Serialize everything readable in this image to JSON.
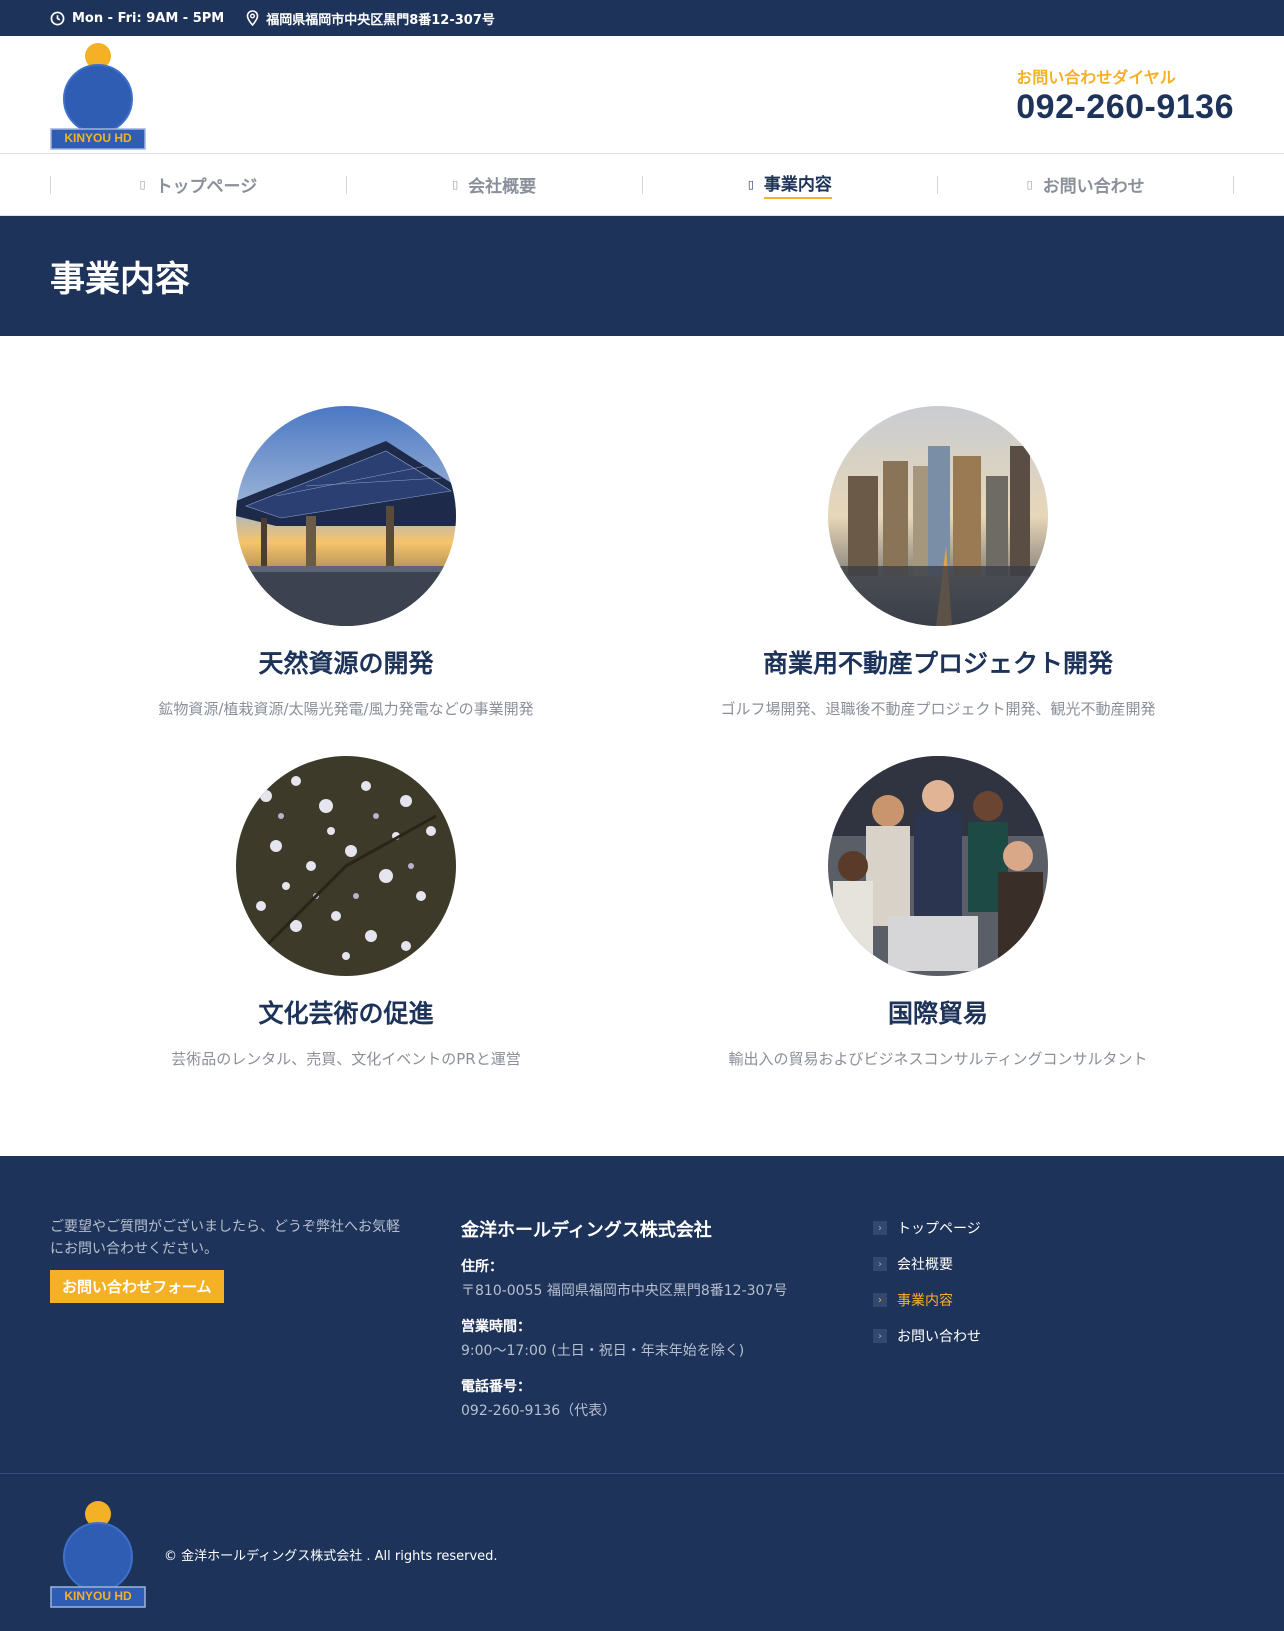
{
  "topbar": {
    "hours": "Mon - Fri: 9AM - 5PM",
    "address": "福岡県福岡市中央区黒門8番12-307号"
  },
  "brand": {
    "logo_text": "KINYOU HD",
    "colors": {
      "navy": "#1e3359",
      "gold": "#f5b125",
      "logo_blue": "#2f5db3"
    }
  },
  "contact": {
    "dial_label": "お問い合わせダイヤル",
    "dial_number": "092-260-9136"
  },
  "nav": {
    "items": [
      {
        "label": "トップページ",
        "active": false
      },
      {
        "label": "会社概要",
        "active": false
      },
      {
        "label": "事業内容",
        "active": true
      },
      {
        "label": "お問い合わせ",
        "active": false
      }
    ]
  },
  "page": {
    "title": "事業内容"
  },
  "services": [
    {
      "title": "天然資源の開発",
      "description": "鉱物資源/植栽資源/太陽光発電/風力発電などの事業開発",
      "image": "solar-panels-photo"
    },
    {
      "title": "商業用不動産プロジェクト開発",
      "description": "ゴルフ場開発、退職後不動産プロジェクト開発、観光不動産開発",
      "image": "city-skyline-photo"
    },
    {
      "title": "文化芸術の促進",
      "description": "芸術品のレンタル、売買、文化イベントのPRと運営",
      "image": "blossom-tree-photo"
    },
    {
      "title": "国際貿易",
      "description": "輸出入の貿易およびビジネスコンサルティングコンサルタント",
      "image": "business-team-photo"
    }
  ],
  "footer": {
    "message": "ご要望やご質問がございましたら、どうぞ弊社へお気軽にお問い合わせください。",
    "form_button": "お問い合わせフォーム",
    "company": "金洋ホールディングス株式会社",
    "address_label": "住所：",
    "address_value": "〒810-0055 福岡県福岡市中央区黒門8番12-307号",
    "hours_label": "営業時間：",
    "hours_value": "9:00〜17:00 (土日・祝日・年末年始を除く)",
    "phone_label": "電話番号：",
    "phone_value": "092-260-9136（代表）",
    "links": [
      {
        "label": "トップページ",
        "active": false
      },
      {
        "label": "会社概要",
        "active": false
      },
      {
        "label": "事業内容",
        "active": true
      },
      {
        "label": "お問い合わせ",
        "active": false
      }
    ],
    "copyright": "© 金洋ホールディングス株式会社 . All rights reserved."
  }
}
